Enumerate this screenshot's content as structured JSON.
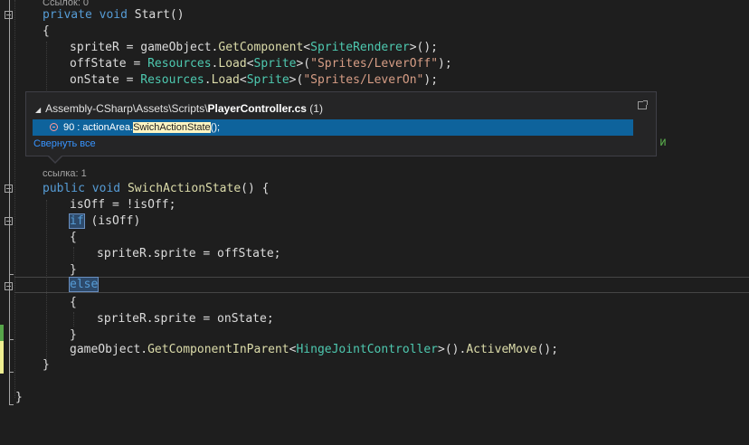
{
  "editor": {
    "lens_top": "Ссылок: 0",
    "lens_mid": "ссылка: 1",
    "close_fragment": "и",
    "lines": {
      "start_decl": {
        "kw1": "private",
        "kw2": "void",
        "name": "Start",
        "rest": "()"
      },
      "brace_open1": "{",
      "l1": {
        "a": "spriteR = gameObject.",
        "fn": "GetComponent",
        "lt": "<",
        "ty": "SpriteRenderer",
        "end": ">();"
      },
      "l2": {
        "a": "offState = ",
        "ty1": "Resources",
        "b": ".",
        "fn": "Load",
        "lt": "<",
        "ty2": "Sprite",
        "c": ">(",
        "str": "\"Sprites/LeverOff\"",
        "end": ");"
      },
      "l3": {
        "a": "onState = ",
        "ty1": "Resources",
        "b": ".",
        "fn": "Load",
        "lt": "<",
        "ty2": "Sprite",
        "c": ">(",
        "str": "\"Sprites/LeverOn\"",
        "end": ");"
      },
      "swich_decl": {
        "kw1": "public",
        "kw2": "void",
        "name": "SwichActionState",
        "rest": "() {"
      },
      "isoff": "isOff = !isOff;",
      "if_kw": "if",
      "if_rest": " (isOff)",
      "brace_a": "{",
      "sprite_off": "spriteR.sprite = offState;",
      "brace_b": "}",
      "else_kw": "else",
      "brace_c": "{",
      "sprite_on": "spriteR.sprite = onState;",
      "brace_d": "}",
      "gocall": {
        "a": "gameObject.",
        "fn1": "GetComponentInParent",
        "lt": "<",
        "ty": "HingeJointController",
        "b": ">().",
        "fn2": "ActiveMove",
        "end": "();"
      },
      "brace_method_close": "}",
      "brace_class_close": "}"
    }
  },
  "peek": {
    "header_prefix": "Assembly-CSharp\\Assets\\Scripts\\",
    "header_file": "PlayerController.cs",
    "header_count": "(1)",
    "row_prefix": "90 : actionArea.",
    "row_highlight": "SwichActionState",
    "row_suffix": "();",
    "collapse_all": "Свернуть все"
  },
  "colors": {
    "keyword": "#569cd6",
    "type": "#4ec9b0",
    "method": "#dcdcaa",
    "string": "#d69d85",
    "selection": "#0e639c",
    "changed_saved": "#57a64a",
    "changed_unsaved": "#efef91"
  }
}
